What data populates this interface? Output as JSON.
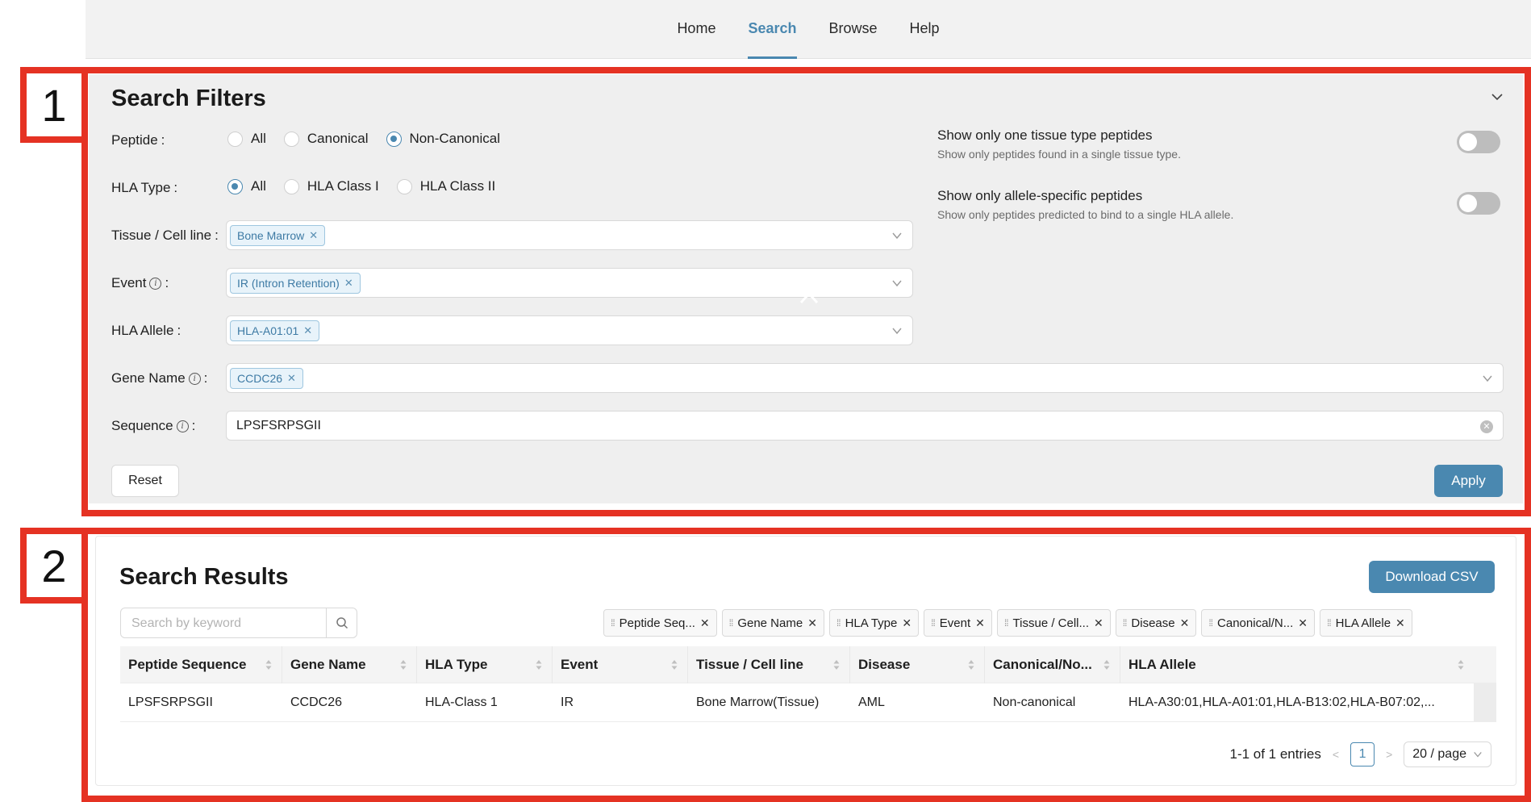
{
  "nav": {
    "items": [
      {
        "label": "Home",
        "active": false
      },
      {
        "label": "Search",
        "active": true
      },
      {
        "label": "Browse",
        "active": false
      },
      {
        "label": "Help",
        "active": false
      }
    ],
    "accent": "#4a88b0"
  },
  "annotations": {
    "box1": "1",
    "box2": "2",
    "color": "#e53223"
  },
  "filters": {
    "title": "Search Filters",
    "peptide": {
      "label": "Peptide",
      "options": [
        "All",
        "Canonical",
        "Non-Canonical"
      ],
      "selected": "Non-Canonical"
    },
    "hla_type": {
      "label": "HLA Type",
      "options": [
        "All",
        "HLA Class I",
        "HLA Class II"
      ],
      "selected": "All"
    },
    "tissue": {
      "label": "Tissue / Cell line",
      "tag": "Bone Marrow"
    },
    "event": {
      "label": "Event",
      "tag": "IR (Intron Retention)"
    },
    "hla_allele": {
      "label": "HLA Allele",
      "tag": "HLA-A01:01"
    },
    "gene_name": {
      "label": "Gene Name",
      "tag": "CCDC26"
    },
    "sequence": {
      "label": "Sequence",
      "value": "LPSFSRPSGII"
    },
    "colon": ":",
    "toggle_tissue": {
      "title": "Show only one tissue type peptides",
      "desc": "Show only peptides found in a single tissue type.",
      "on": false
    },
    "toggle_allele": {
      "title": "Show only allele-specific peptides",
      "desc": "Show only peptides predicted to bind to a single HLA allele.",
      "on": false
    },
    "reset_label": "Reset",
    "apply_label": "Apply"
  },
  "results": {
    "title": "Search Results",
    "download_label": "Download CSV",
    "search_placeholder": "Search by keyword",
    "column_chips": [
      "Peptide Seq...",
      "Gene Name",
      "HLA Type",
      "Event",
      "Tissue / Cell...",
      "Disease",
      "Canonical/N...",
      "HLA Allele"
    ],
    "columns": [
      "Peptide Sequence",
      "Gene Name",
      "HLA Type",
      "Event",
      "Tissue / Cell line",
      "Disease",
      "Canonical/No...",
      "HLA Allele"
    ],
    "rows": [
      [
        "LPSFSRPSGII",
        "CCDC26",
        "HLA-Class 1",
        "IR",
        "Bone Marrow(Tissue)",
        "AML",
        "Non-canonical",
        "HLA-A30:01,HLA-A01:01,HLA-B13:02,HLA-B07:02,..."
      ]
    ],
    "pagination": {
      "summary": "1-1 of 1 entries",
      "current_page": "1",
      "page_size": "20 / page"
    }
  }
}
